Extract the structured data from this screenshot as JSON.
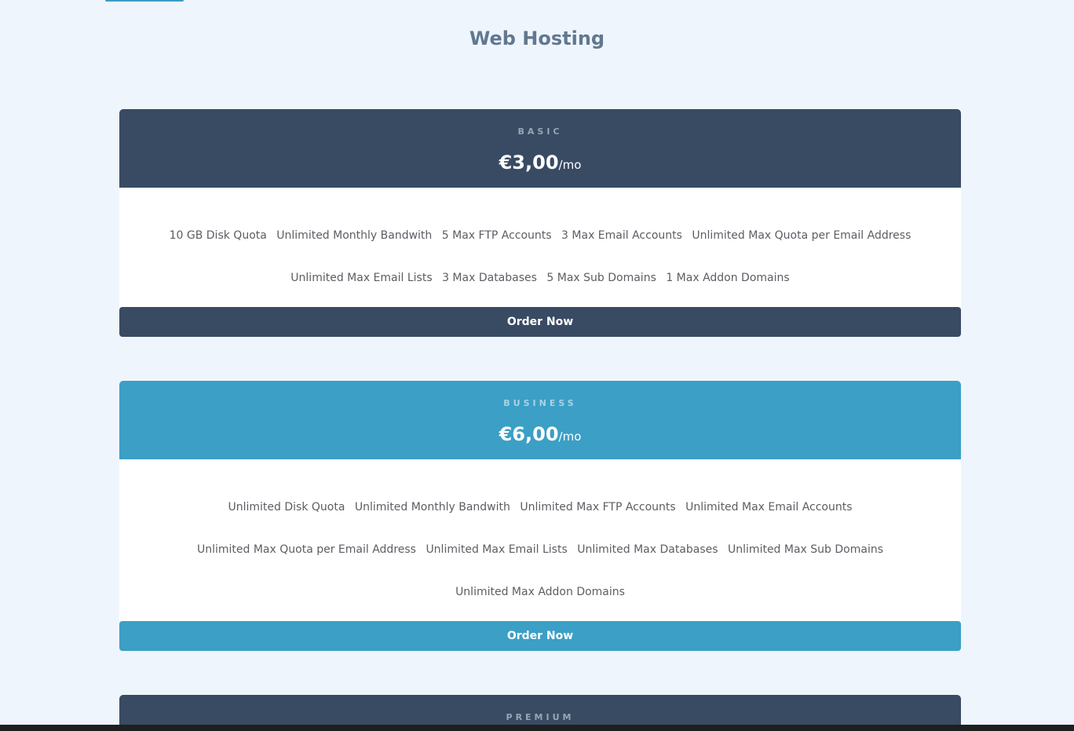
{
  "page": {
    "title": "Web Hosting"
  },
  "colors": {
    "background": "#eff5fc",
    "dark_plan": "#384b63",
    "blue_plan": "#3b9fc6",
    "title_text": "#627891",
    "feature_text": "#5b5e63"
  },
  "plans": [
    {
      "name": "BASIC",
      "price": "€3,00",
      "period": "/mo",
      "features": [
        "10 GB Disk Quota",
        "Unlimited Monthly Bandwith",
        "5 Max FTP Accounts",
        "3 Max Email Accounts",
        "Unlimited Max Quota per Email Address",
        "Unlimited Max Email Lists",
        "3 Max Databases",
        "5 Max Sub Domains",
        "1 Max Addon Domains"
      ],
      "order_label": "Order Now"
    },
    {
      "name": "BUSINESS",
      "price": "€6,00",
      "period": "/mo",
      "features": [
        "Unlimited Disk Quota",
        "Unlimited Monthly Bandwith",
        "Unlimited Max FTP Accounts",
        "Unlimited Max Email Accounts",
        "Unlimited Max Quota per Email Address",
        "Unlimited Max Email Lists",
        "Unlimited Max Databases",
        "Unlimited Max Sub Domains",
        "Unlimited Max Addon Domains"
      ],
      "order_label": "Order Now"
    },
    {
      "name": "PREMIUM"
    }
  ]
}
